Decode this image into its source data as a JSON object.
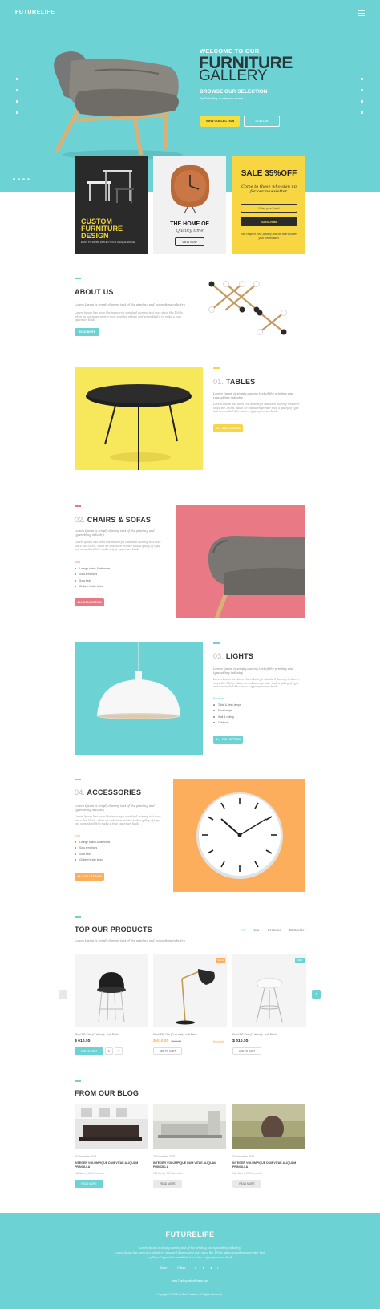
{
  "header": {
    "logo": "FUTURELIFE"
  },
  "hero": {
    "welcome": "WELCOME TO OUR",
    "title_bold": "FURNITURE",
    "title_light": "GALLERY",
    "browse": "BROWSE OUR SELECTION",
    "browse_sub": "By Selecting a category above",
    "btn_view": "VIEW COLLECTION",
    "btn_follow": "FOLLOW"
  },
  "promo": {
    "dark_title": "CUSTOM FURNITURE DESIGN",
    "dark_sub": "EASY TO WORK WITHIN YOUR UNIQUE SPACE",
    "clock_title": "THE HOME OF",
    "clock_sub": "Quality time",
    "clock_btn": "VIEW NOW",
    "sale_title": "SALE 35%OFF",
    "sale_desc": "Come to these who sign up for our newsletter.",
    "sale_email_placeholder": "Enter your Email",
    "sale_subscribe": "SUBSCRIBE",
    "sale_note": "We respect your privacy and we won't share your information."
  },
  "about": {
    "title": "ABOUT US",
    "lead": "Lorem Ipsum is simply dummy text of the printing and typesetting industry.",
    "para": "Lorem Ipsum has been the industry's standard dummy text ever since the 1500s, when an unknown printer took a galley of type and scrambled it to make a type specimen book.",
    "btn": "READ MORE"
  },
  "tables": {
    "num": "01.",
    "title": "TABLES",
    "lead": "Lorem Ipsum is simply dummy text of the printing and typesetting industry.",
    "para": "Lorem Ipsum has been the industry's standard dummy text ever since the 1500s, when an unknown printer took a galley of type and scrambled it to make a type specimen book.",
    "btn": "ALL COLLECTION"
  },
  "chairs": {
    "num": "02.",
    "title": "CHAIRS & SOFAS",
    "lead": "Lorem Ipsum is simply dummy text of the printing and typesetting industry.",
    "para": "Lorem Ipsum has been the industry's standard dummy text ever since the 1500s, when an unknown printer took a galley of type and scrambled it to make a type specimen book.",
    "list_head": "Sofa",
    "list": [
      "Lounge chairs & ottomans",
      "Sofa armchairs",
      "Sofa beds",
      "Children's day beds"
    ],
    "btn": "ALL COLLECTION"
  },
  "lights": {
    "num": "03.",
    "title": "LIGHTS",
    "lead": "Lorem Ipsum is simply dummy text of the printing and typesetting industry.",
    "para": "Lorem Ipsum has been the industry's standard dummy text ever since the 1500s, when an unknown printer took a galley of type and scrambled it to make a type specimen book.",
    "list_head": "Pendants",
    "list": [
      "Table & desk lamps",
      "Floor lamps",
      "Wall & ceiling",
      "Outdoor"
    ],
    "btn": "ALL COLLECTION"
  },
  "accessories": {
    "num": "04.",
    "title": "ACCESSORIES",
    "lead": "Lorem Ipsum is simply dummy text of the printing and typesetting industry.",
    "para": "Lorem Ipsum has been the industry's standard dummy text ever since the 1500s, when an unknown printer took a galley of type and scrambled it to make a type specimen book.",
    "list_head": "Sofa",
    "list": [
      "Lounge chairs & ottomans",
      "Sofa armchairs",
      "Sofa beds",
      "Children's day beds"
    ],
    "btn": "ALL COLLECTION"
  },
  "products": {
    "title": "TOP OUR PRODUCTS",
    "lead": "Lorem Ipsum is simply dummy text of the printing and typesetting industry.",
    "tabs": [
      "All",
      "New",
      "Featured",
      "Bestseller"
    ],
    "items": [
      {
        "name": "Stool 'FF' Chic (O oil rust) - soft Black",
        "price": "$ 610.95",
        "old": "",
        "btn": "ADD TO CART",
        "badge": ""
      },
      {
        "name": "Stool 'FF' Chic (O oil rust) - soft Black",
        "price": "$ 610.95",
        "old": "$870.95",
        "btn": "ADD TO CART",
        "badge": "SALE",
        "extra": "Bestseller"
      },
      {
        "name": "Stool 'FF' Chic (O oil rust) - soft Black",
        "price": "$ 610.95",
        "old": "",
        "btn": "ADD TO CART",
        "badge": "NEW"
      }
    ]
  },
  "blog": {
    "title": "FROM OUR BLOG",
    "posts": [
      {
        "date": "20 November 2016",
        "title": "INTEGER VOLUMPIQUE DUM VITAE ALIQUAM PRINCILLA",
        "likes": "166 likes",
        "comments": "23 Comments",
        "btn": "READ MORE"
      },
      {
        "date": "20 November 2016",
        "title": "INTEGER VOLUMPIQUE DUM VITAE ALIQUAM PRINCILLA",
        "likes": "166 likes",
        "comments": "23 Comments",
        "btn": "READ MORE"
      },
      {
        "date": "20 November 2016",
        "title": "INTEGER VOLUMPIQUE DUM VITAE ALIQUAM PRINCILLA",
        "likes": "166 likes",
        "comments": "23 Comments",
        "btn": "READ MORE"
      }
    ]
  },
  "footer": {
    "logo": "FUTURELIFE",
    "text1": "Lorem Ipsum is simply dummy text of the printing and typesetting industry.",
    "text2": "Lorem Ipsum has been the industry's standard dummy text ever since the 1500s, when an unknown printer took",
    "text3": "a galley of type and scrambled it to make a type specimen book.",
    "share": "Share",
    "follow": "Follow",
    "website": "www.TheInspirationPhotos.com",
    "copyright": "Copyright © 2016 by Rise Creative. All Rights Reserved."
  },
  "colors": {
    "teal": "#6dd2d4",
    "yellow": "#f7d642",
    "pink": "#e87985",
    "orange": "#fcae5d",
    "dark": "#2a2a2a"
  }
}
